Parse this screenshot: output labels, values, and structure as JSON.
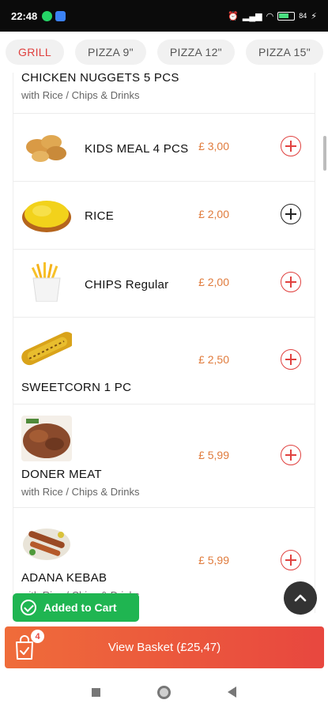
{
  "status_bar": {
    "time": "22:48",
    "battery": "84"
  },
  "tabs": [
    {
      "label": "GRILL",
      "active": true
    },
    {
      "label": "PIZZA 9\"",
      "active": false
    },
    {
      "label": "PIZZA 12\"",
      "active": false
    },
    {
      "label": "PIZZA 15\"",
      "active": false
    }
  ],
  "menu": {
    "items": [
      {
        "name": "CHICKEN NUGGETS 5 PCS",
        "subtitle": "with Rice / Chips & Drinks"
      },
      {
        "name": "KIDS MEAL 4 PCS",
        "price": "£ 3,00",
        "image": "nuggets"
      },
      {
        "name": "RICE",
        "price": "£ 2,00",
        "image": "rice"
      },
      {
        "name": "CHIPS Regular",
        "price": "£ 2,00",
        "image": "chips"
      },
      {
        "name": "SWEETCORN 1 PC",
        "price": "£ 2,50",
        "image": "sweetcorn"
      },
      {
        "name": "DONER MEAT",
        "subtitle": "with Rice / Chips & Drinks",
        "price": "£ 5,99",
        "image": "doner"
      },
      {
        "name": "ADANA KEBAB",
        "subtitle": "with Rice / Chips & Drinks",
        "price": "£ 5,99",
        "image": "kebab"
      }
    ]
  },
  "toast": {
    "label": "Added to Cart"
  },
  "basket": {
    "label": "View Basket (£25,47)",
    "count": "4"
  },
  "icons": {
    "add": "plus-circle-icon",
    "up": "chevron-up-icon",
    "basket": "shopping-bag-icon"
  },
  "colors": {
    "accent": "#e0413f",
    "price": "#e07b3c",
    "toast": "#1fb551"
  }
}
